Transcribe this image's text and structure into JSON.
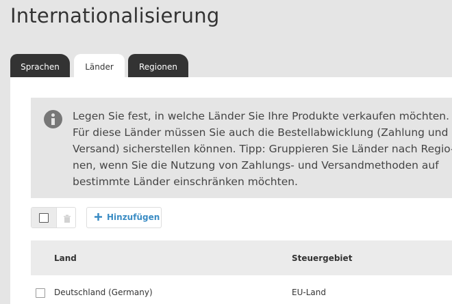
{
  "page": {
    "title": "Internationalisierung"
  },
  "tabs": [
    {
      "label": "Sprachen",
      "active": false
    },
    {
      "label": "Länder",
      "active": true
    },
    {
      "label": "Regionen",
      "active": false
    }
  ],
  "info": {
    "icon": "info-icon",
    "lines": [
      "Legen Sie fest, in welche Länder Sie Ihre Produkte verkaufen möchten.",
      "Für diese Länder müssen Sie auch die Bestellabwicklung (Zahlung und",
      "Versand) sicherstellen können. Tipp: Gruppieren Sie Länder nach Regio-",
      "nen, wenn Sie die Nutzung von Zahlungs- und Versandmethoden auf",
      "bestimmte Länder einschränken möchten."
    ]
  },
  "toolbar": {
    "add_label": "Hinzufügen",
    "add_icon": "plus-icon",
    "delete_icon": "trash-icon"
  },
  "table": {
    "columns": [
      "Land",
      "Steuergebiet"
    ],
    "rows": [
      {
        "land": "Deutschland (Germany)",
        "steuergebiet": "EU-Land",
        "selected": false
      }
    ]
  },
  "colors": {
    "background": "#e5e5e5",
    "tab_dark": "#333333",
    "accent": "#3a8cc4"
  }
}
